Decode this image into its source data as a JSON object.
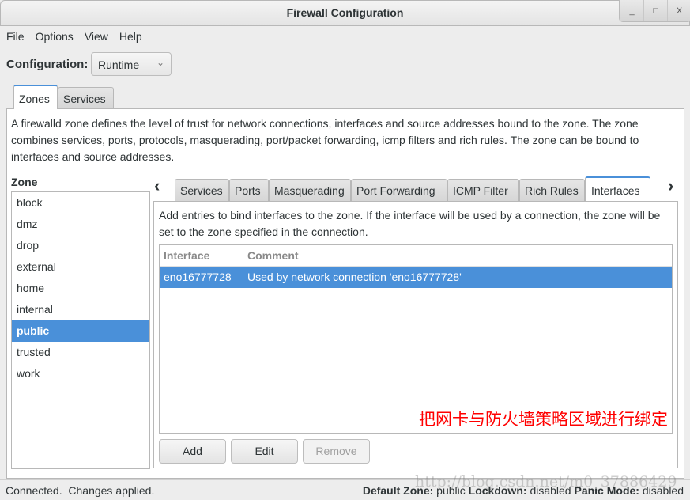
{
  "window": {
    "title": "Firewall Configuration",
    "buttons": [
      "_",
      "□",
      "X"
    ]
  },
  "menu": [
    "File",
    "Options",
    "View",
    "Help"
  ],
  "configuration": {
    "label": "Configuration:",
    "value": "Runtime"
  },
  "main_tabs": [
    {
      "label": "Zones",
      "active": true
    },
    {
      "label": "Services",
      "active": false
    }
  ],
  "zones_description": "A firewalld zone defines the level of trust for network connections, interfaces and source addresses bound to the zone. The zone combines services, ports, protocols, masquerading, port/packet forwarding, icmp filters and rich rules. The zone can be bound to interfaces and source addresses.",
  "zone_list": {
    "label": "Zone",
    "items": [
      "block",
      "dmz",
      "drop",
      "external",
      "home",
      "internal",
      "public",
      "trusted",
      "work"
    ],
    "selected": "public"
  },
  "zone_tabs": [
    {
      "label": "Services"
    },
    {
      "label": "Ports"
    },
    {
      "label": "Masquerading"
    },
    {
      "label": "Port Forwarding"
    },
    {
      "label": "ICMP Filter"
    },
    {
      "label": "Rich Rules"
    },
    {
      "label": "Interfaces",
      "active": true
    }
  ],
  "interfaces": {
    "description": "Add entries to bind interfaces to the zone. If the interface will be used by a connection, the zone will be set to the zone specified in the connection.",
    "columns": [
      "Interface",
      "Comment"
    ],
    "rows": [
      {
        "interface": "eno16777728",
        "comment": "Used by network connection 'eno16777728'",
        "selected": true
      }
    ],
    "buttons": {
      "add": "Add",
      "edit": "Edit",
      "remove": "Remove"
    }
  },
  "annotation": "把网卡与防火墙策略区域进行绑定",
  "status": {
    "left": "Connected.  Changes applied.",
    "default_zone_label": "Default Zone:",
    "default_zone": "public",
    "lockdown_label": "Lockdown:",
    "lockdown": "disabled",
    "panic_label": "Panic Mode:",
    "panic": "disabled"
  },
  "watermark": "http://blog.csdn.net/m0_37886429",
  "colors": {
    "selection": "#4a90d9",
    "annotation": "#ff0000"
  }
}
